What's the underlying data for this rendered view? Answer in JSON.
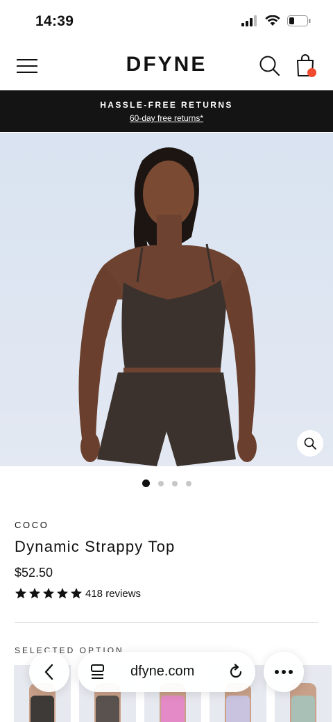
{
  "status": {
    "time": "14:39"
  },
  "header": {
    "logo": "DFYNE"
  },
  "promo": {
    "title": "HASSLE-FREE RETURNS",
    "subtitle": "60-day free returns*"
  },
  "carousel": {
    "total": 4,
    "active_index": 0
  },
  "product": {
    "brand": "COCO",
    "title": "Dynamic Strappy Top",
    "price": "$52.50",
    "rating": 5,
    "reviews": "418 reviews",
    "selected_option_label": "SELECTED OPTION"
  },
  "swatches": [
    {
      "color": "#3d3a38"
    },
    {
      "color": "#5a524e"
    },
    {
      "color": "#e48ac6"
    },
    {
      "color": "#c9c3e0"
    },
    {
      "color": "#a8c0b6"
    }
  ],
  "browser": {
    "url": "dfyne.com"
  },
  "colors": {
    "accent_dot": "#f04a2f",
    "banner_bg": "#141414"
  }
}
